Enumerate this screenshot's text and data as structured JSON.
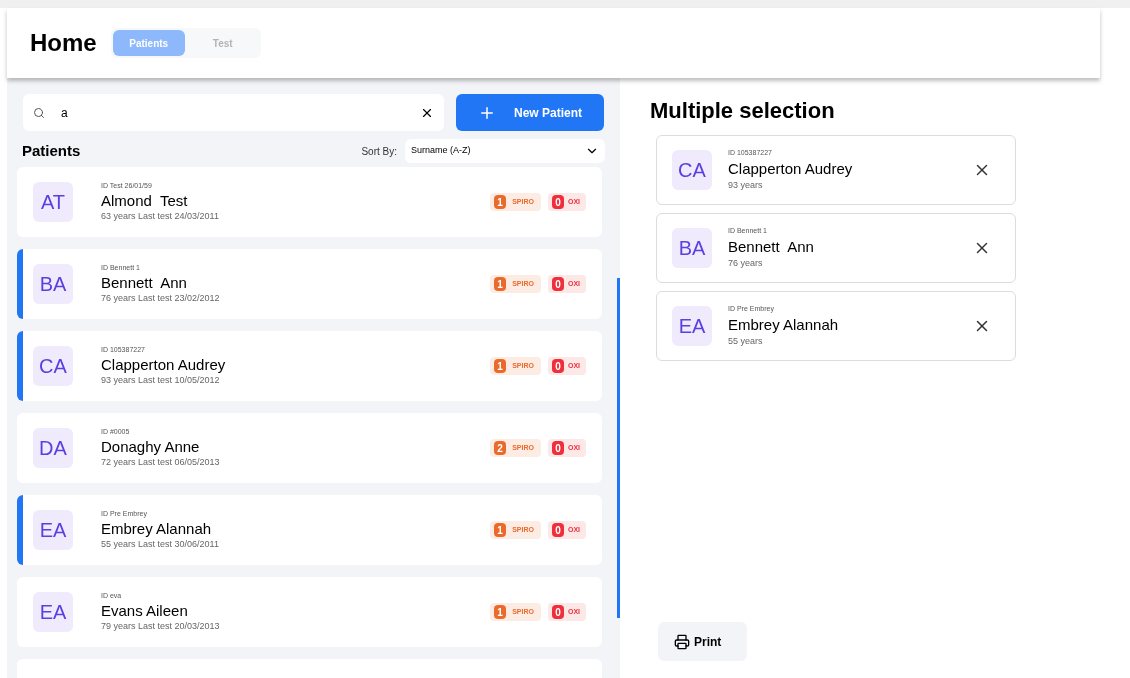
{
  "header": {
    "title": "Home",
    "tabs": [
      {
        "label": "Patients",
        "selected": true
      },
      {
        "label": "Test",
        "selected": false
      }
    ]
  },
  "search": {
    "value": "a"
  },
  "new_patient_button": "New Patient",
  "list_title": "Patients",
  "sort": {
    "label": "Sort By:",
    "value": "Surname (A-Z)"
  },
  "patients": [
    {
      "initials": "AT",
      "id": "ID Test 26/01/59",
      "name": "Almond  Test",
      "info": "63 years Last test 24/03/2011",
      "spiro": "1",
      "spiro_label": "SPIRO",
      "oxi": "0",
      "oxi_label": "OXI",
      "selected": false
    },
    {
      "initials": "BA",
      "id": "ID Bennett 1",
      "name": "Bennett  Ann",
      "info": "76 years Last test 23/02/2012",
      "spiro": "1",
      "spiro_label": "SPIRO",
      "oxi": "0",
      "oxi_label": "OXI",
      "selected": true
    },
    {
      "initials": "CA",
      "id": "ID 105387227",
      "name": "Clapperton Audrey",
      "info": "93 years Last test 10/05/2012",
      "spiro": "1",
      "spiro_label": "SPIRO",
      "oxi": "0",
      "oxi_label": "OXI",
      "selected": true
    },
    {
      "initials": "DA",
      "id": "ID #0005",
      "name": "Donaghy Anne",
      "info": "72 years Last test 06/05/2013",
      "spiro": "2",
      "spiro_label": "SPIRO",
      "oxi": "0",
      "oxi_label": "OXI",
      "selected": false
    },
    {
      "initials": "EA",
      "id": "ID Pre Embrey",
      "name": "Embrey Alannah",
      "info": "55 years Last test 30/06/2011",
      "spiro": "1",
      "spiro_label": "SPIRO",
      "oxi": "0",
      "oxi_label": "OXI",
      "selected": true
    },
    {
      "initials": "EA",
      "id": "ID eva",
      "name": "Evans Aileen",
      "info": "79 years Last test 20/03/2013",
      "spiro": "1",
      "spiro_label": "SPIRO",
      "oxi": "0",
      "oxi_label": "OXI",
      "selected": false
    }
  ],
  "selection": {
    "title": "Multiple selection",
    "items": [
      {
        "initials": "CA",
        "id": "ID 105387227",
        "name": "Clapperton Audrey",
        "age": "93 years"
      },
      {
        "initials": "BA",
        "id": "ID Bennett 1",
        "name": "Bennett  Ann",
        "age": "76 years"
      },
      {
        "initials": "EA",
        "id": "ID Pre Embrey",
        "name": "Embrey Alannah",
        "age": "55 years"
      }
    ]
  },
  "print_button": "Print"
}
